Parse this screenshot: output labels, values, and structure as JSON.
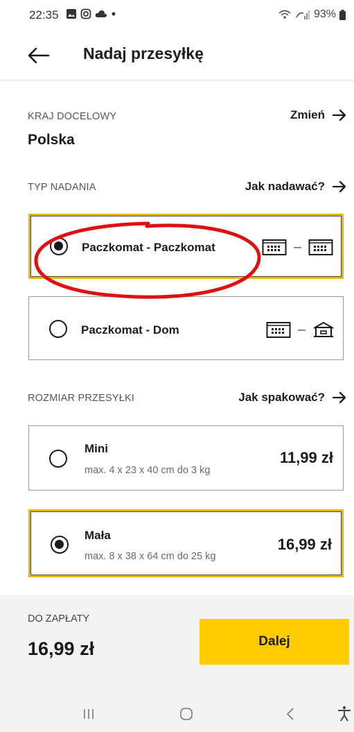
{
  "status_bar": {
    "time": "22:35",
    "battery": "93%",
    "left_icons": [
      "gallery-icon",
      "instagram-icon",
      "cloud-icon",
      "dot-icon"
    ],
    "right_icons": [
      "wifi-icon",
      "signal-icon",
      "battery-icon"
    ]
  },
  "header": {
    "title": "Nadaj przesyłkę",
    "back_icon": "arrow-left-icon"
  },
  "destination": {
    "label": "KRAJ DOCELOWY",
    "value": "Polska",
    "change_link": "Zmień"
  },
  "shipping_type": {
    "label": "TYP NADANIA",
    "help_link": "Jak nadawać?",
    "options": [
      {
        "label": "Paczkomat - Paczkomat",
        "selected": true,
        "icons": [
          "locker-icon",
          "locker-icon"
        ]
      },
      {
        "label": "Paczkomat - Dom",
        "selected": false,
        "icons": [
          "locker-icon",
          "house-icon"
        ]
      }
    ]
  },
  "package_size": {
    "label": "ROZMIAR PRZESYŁKI",
    "help_link": "Jak spakować?",
    "options": [
      {
        "label": "Mini",
        "detail": "max. 4 x 23 x 40 cm do 3 kg",
        "price": "11,99 zł",
        "selected": false
      },
      {
        "label": "Mała",
        "detail": "max. 8 x 38 x 64 cm do 25 kg",
        "price": "16,99 zł",
        "selected": true
      }
    ]
  },
  "footer": {
    "pay_label": "DO ZAPŁATY",
    "amount": "16,99 zł",
    "next_button": "Dalej"
  },
  "nav_bar": {
    "buttons": [
      "recents-icon",
      "home-icon",
      "back-icon",
      "accessibility-icon"
    ]
  },
  "colors": {
    "accent": "#ffcc00",
    "selected_border": "#e6b800",
    "annotation": "#e01010"
  }
}
